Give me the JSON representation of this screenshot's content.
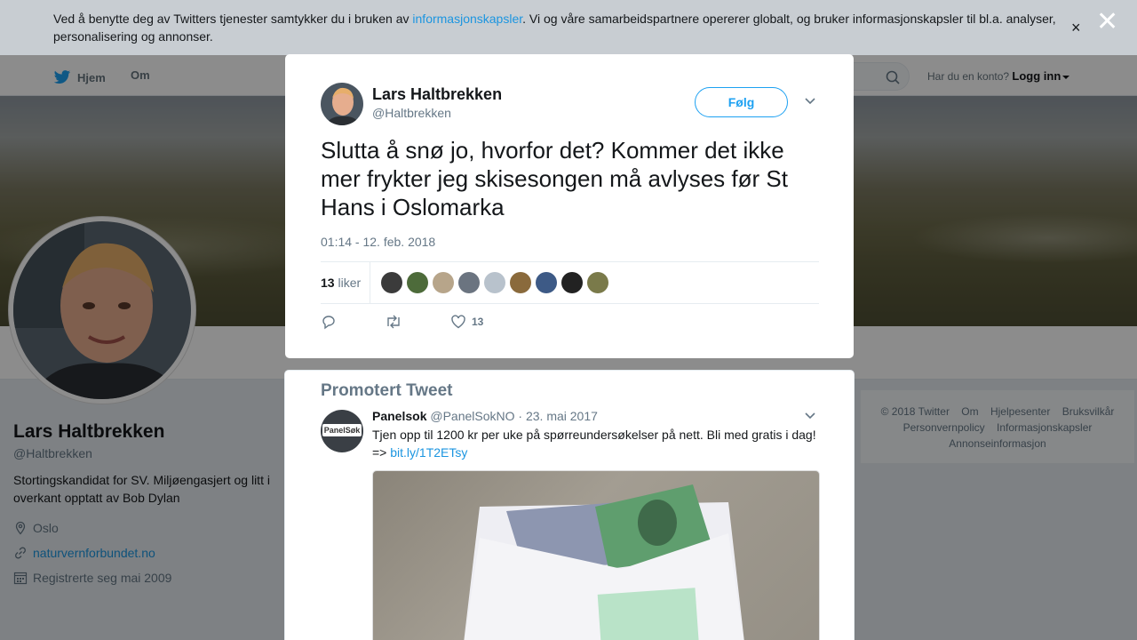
{
  "cookie_banner": {
    "text_before": "Ved å benytte deg av Twitters tjenester samtykker du i bruken av ",
    "link": "informasjonskapsler",
    "text_after": ". Vi og våre samarbeidspartnere opererer globalt, og bruker informasjonskapsler til bl.a. analyser, personalisering og annonser.",
    "close": "×"
  },
  "modal_close": "✕",
  "nav": {
    "home": "Hjem",
    "about": "Om",
    "has_account": "Har du en konto?",
    "login": "Logg inn"
  },
  "profile": {
    "name": "Lars Haltbrekken",
    "handle": "@Haltbrekken",
    "bio": "Stortingskandidat for SV. Miljøengasjert og litt i overkant opptatt av Bob Dylan",
    "location": "Oslo",
    "website": "naturvernforbundet.no",
    "joined": "Registrerte seg mai 2009"
  },
  "tweet": {
    "name": "Lars Haltbrekken",
    "handle": "@Haltbrekken",
    "follow": "Følg",
    "text": "Slutta å snø jo, hvorfor det? Kommer det ikke mer frykter jeg skisesongen må avlyses før St Hans i Oslomarka",
    "time": "01:14 - 12. feb. 2018",
    "likes_count": "13",
    "likes_label": "liker",
    "like_action_count": "13",
    "liker_colors": [
      "#3b3b3b",
      "#4d6b3a",
      "#b7a58a",
      "#6b7480",
      "#b8c2cc",
      "#8a6a3c",
      "#3d5a86",
      "#222222",
      "#7a7a4a"
    ]
  },
  "promoted": {
    "heading": "Promotert Tweet",
    "name": "Panelsok",
    "handle": "@PanelSokNO",
    "date": "· 23. mai 2017",
    "text": "Tjen opp til 1200 kr per uke på spørreundersøkelser på nett. Bli med gratis i dag! => ",
    "link": "bit.ly/1T2ETsy",
    "logo": "PanelSøk"
  },
  "footer": {
    "items": [
      "© 2018 Twitter",
      "Om",
      "Hjelpesenter",
      "Bruksvilkår",
      "Personvernpolicy",
      "Informasjonskapsler",
      "Annonseinformasjon"
    ]
  }
}
